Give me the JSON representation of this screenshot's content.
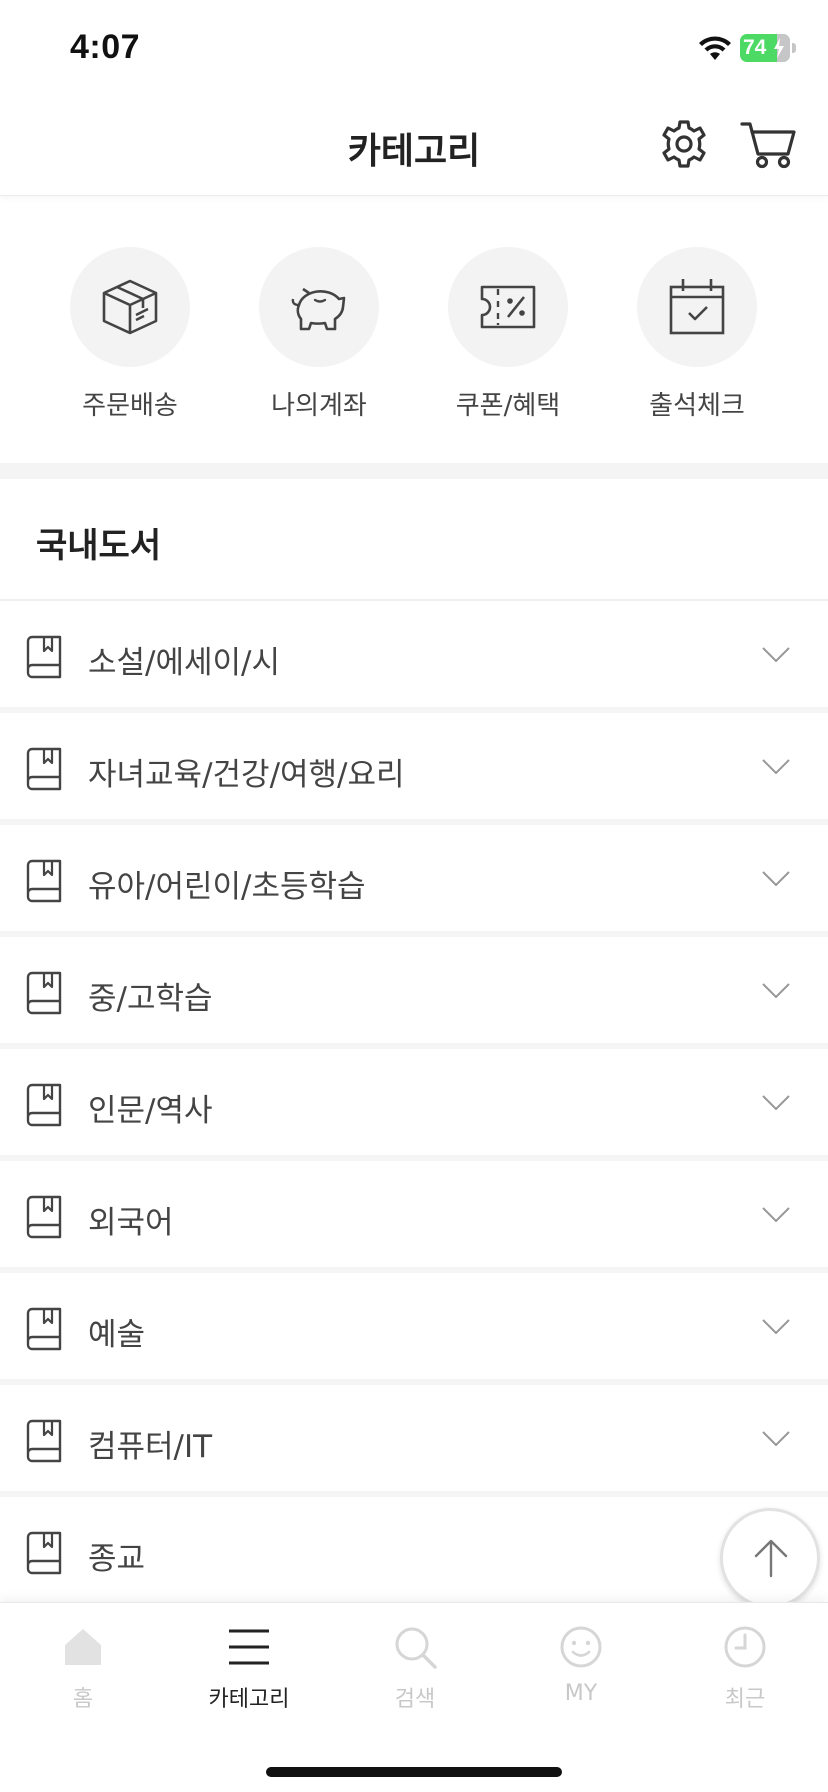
{
  "status_bar": {
    "time": "4:07",
    "battery": "74"
  },
  "header": {
    "title": "카테고리"
  },
  "quick_menu": [
    {
      "label": "주문배송",
      "icon": "box-icon"
    },
    {
      "label": "나의계좌",
      "icon": "piggy-bank-icon"
    },
    {
      "label": "쿠폰/혜택",
      "icon": "coupon-icon"
    },
    {
      "label": "출석체크",
      "icon": "calendar-check-icon"
    }
  ],
  "section": {
    "title": "국내도서",
    "categories": [
      {
        "label": "소설/에세이/시"
      },
      {
        "label": "자녀교육/건강/여행/요리"
      },
      {
        "label": "유아/어린이/초등학습"
      },
      {
        "label": "중/고학습"
      },
      {
        "label": "인문/역사"
      },
      {
        "label": "외국어"
      },
      {
        "label": "예술"
      },
      {
        "label": "컴퓨터/IT"
      },
      {
        "label": "종교"
      }
    ]
  },
  "tab_bar": {
    "active": "카테고리",
    "tabs": [
      {
        "label": "홈",
        "icon": "home-icon"
      },
      {
        "label": "카테고리",
        "icon": "menu-icon"
      },
      {
        "label": "검색",
        "icon": "search-icon"
      },
      {
        "label": "MY",
        "icon": "smiley-icon"
      },
      {
        "label": "최근",
        "icon": "clock-icon"
      }
    ]
  },
  "colors": {
    "battery_green": "#4cd964",
    "text_dark": "#222222",
    "inactive_tab": "#c8c8c8"
  }
}
